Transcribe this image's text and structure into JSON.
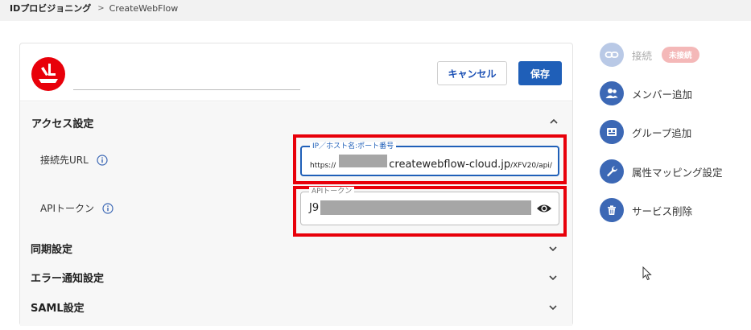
{
  "breadcrumb": {
    "root": "IDプロビジョニング",
    "separator": ">",
    "current": "CreateWebFlow"
  },
  "header": {
    "name_value": "",
    "cancel_label": "キャンセル",
    "save_label": "保存",
    "logo_icon": "createwebflow-logo-icon"
  },
  "sections": {
    "access": {
      "title": "アクセス設定",
      "url_label": "接続先URL",
      "url_legend": "IP／ホスト名:ポート番号",
      "url_prefix": "https://",
      "url_domain": "createwebflow-cloud.jp",
      "url_suffix": "/XFV20/api/",
      "token_label": "APIトークン",
      "token_legend": "APIトークン",
      "token_prefix": "J9"
    },
    "sync": {
      "title": "同期設定"
    },
    "error": {
      "title": "エラー通知設定"
    },
    "saml": {
      "title": "SAML設定"
    }
  },
  "sidebar": {
    "connect_label": "接続",
    "connect_status": "未接続",
    "items": [
      {
        "label": "メンバー追加",
        "icon": "members-icon"
      },
      {
        "label": "グループ追加",
        "icon": "group-icon"
      },
      {
        "label": "属性マッピング設定",
        "icon": "wrench-icon"
      },
      {
        "label": "サービス削除",
        "icon": "trash-icon"
      }
    ]
  },
  "colors": {
    "primary": "#1f5fb8",
    "highlight": "#e8000a",
    "logo_red": "#e8000a",
    "badge": "#f4b8b8"
  }
}
